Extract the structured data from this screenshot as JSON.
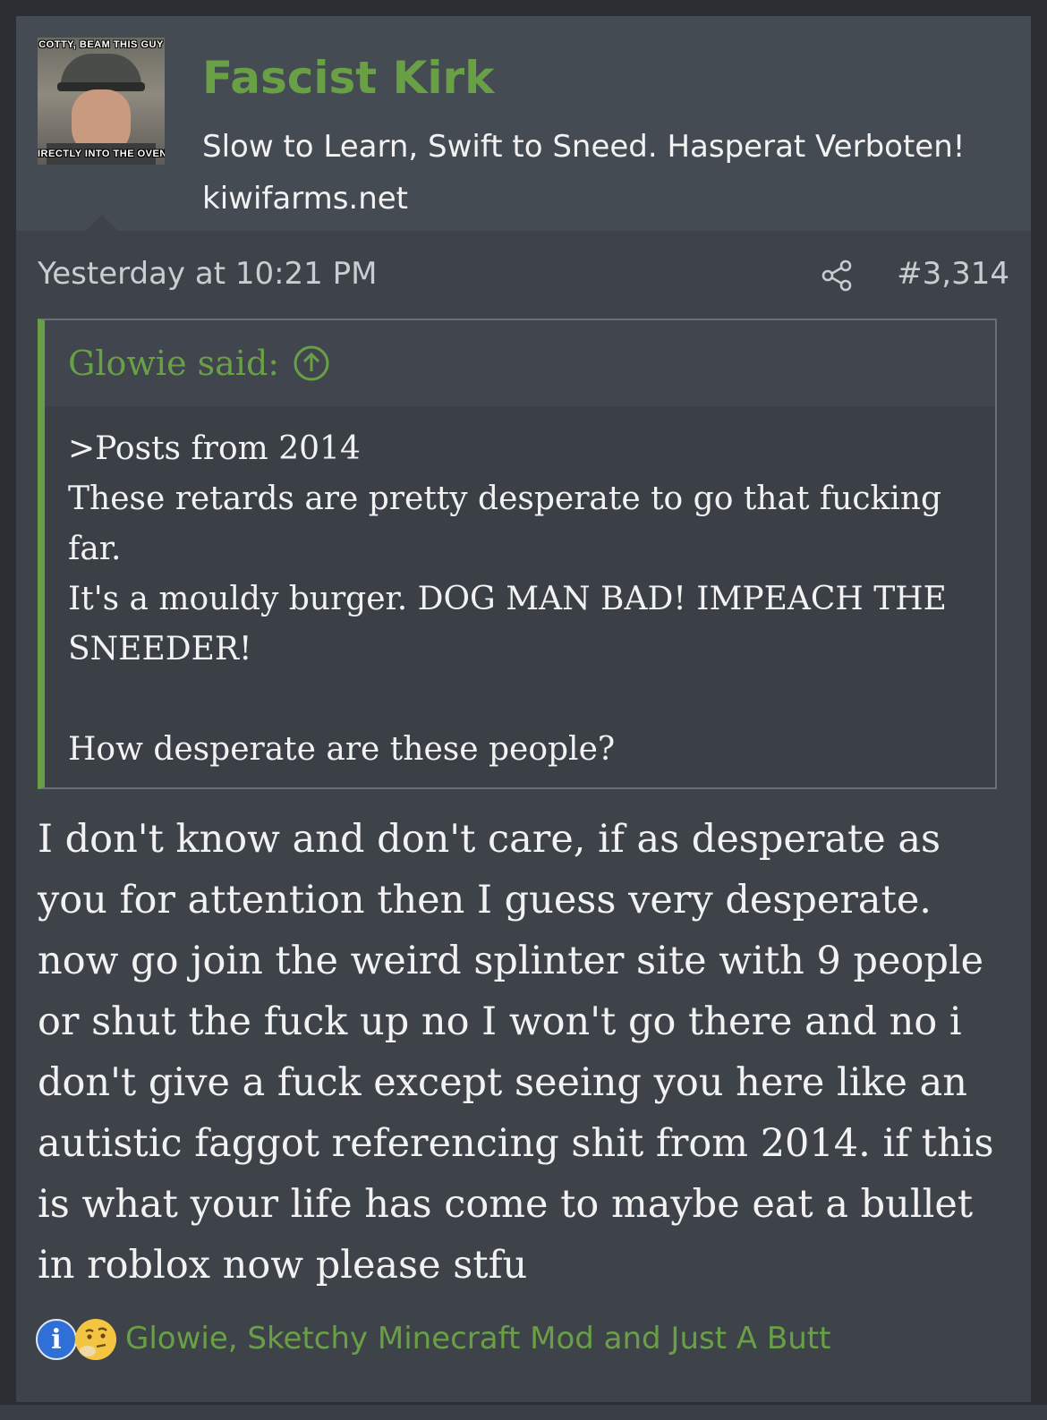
{
  "user": {
    "name": "Fascist Kirk",
    "title": "Slow to Learn, Swift to Sneed. Hasperat Verboten!",
    "site": "kiwifarms.net",
    "avatar": {
      "caption_top": "COTTY, BEAM THIS GUY",
      "caption_bottom": "IRECTLY INTO THE OVEN"
    }
  },
  "post": {
    "timestamp": "Yesterday at 10:21 PM",
    "number": "#3,314",
    "share_icon": "share-icon"
  },
  "quote": {
    "author_label": "Glowie said:",
    "jump_icon": "arrow-up-circle-icon",
    "lines": [
      ">Posts from 2014",
      "These retards are pretty desperate to go that fucking far.",
      "It's a mouldy burger. DOG MAN BAD! IMPEACH THE SNEEDER!",
      "",
      "How desperate are these people?"
    ]
  },
  "message": {
    "text": "I don't know and don't care, if as desperate as you for attention then I guess very desperate. now go join the weird splinter site with 9 people or shut the fuck up no I won't go there and no i don't give a fuck except seeing you here like an autistic faggot referencing shit from 2014. if this is what your life has come to maybe eat a bullet in roblox now please stfu"
  },
  "reactions": {
    "icons": [
      "info-icon",
      "thinking-face-icon"
    ],
    "info_glyph": "i",
    "names": "Glowie, Sketchy Minecraft Mod and Just A Butt"
  },
  "colors": {
    "accent_green": "#69a046",
    "page_bg": "#2b2f33",
    "post_bg": "#3e434a",
    "header_bg": "#454b53",
    "text": "#f2f2f2",
    "muted_text": "#c9ccd0"
  }
}
